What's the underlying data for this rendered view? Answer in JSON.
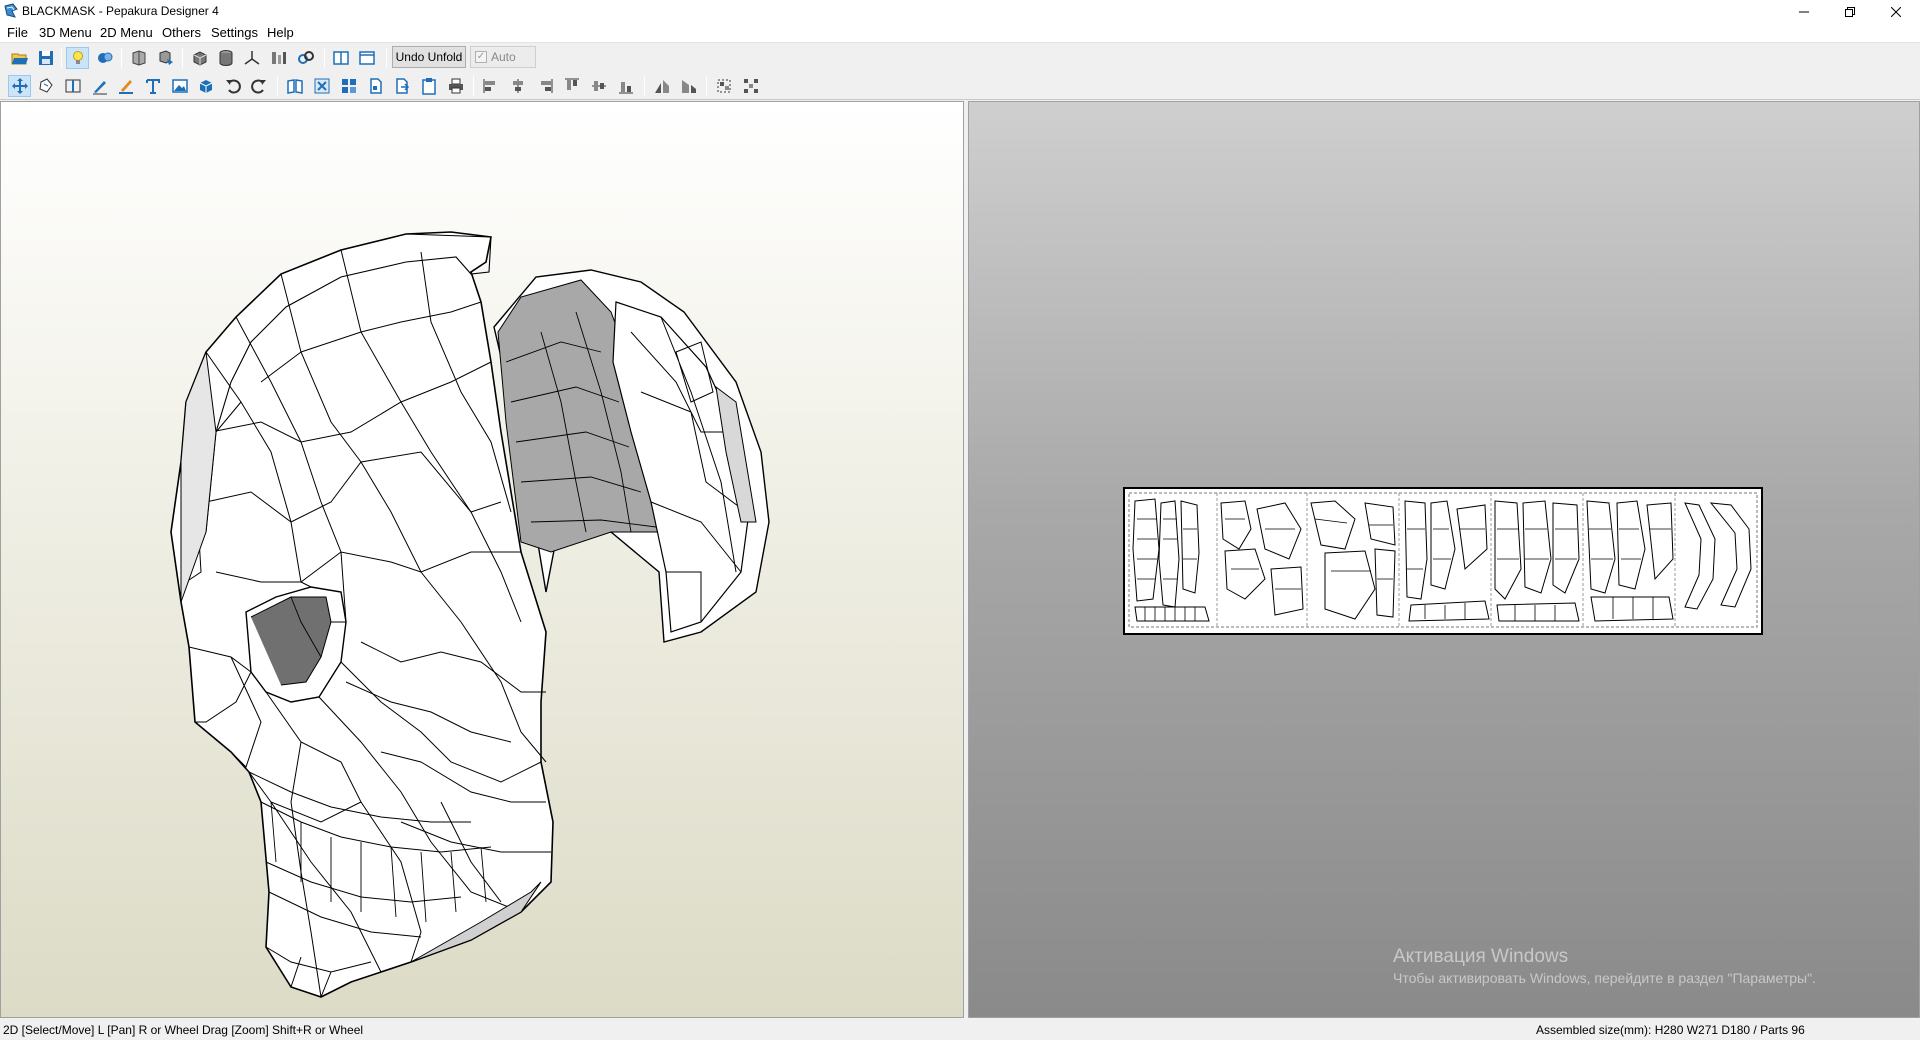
{
  "window": {
    "title": "BLACKMASK - Pepakura Designer 4"
  },
  "menu": {
    "items": [
      {
        "label": "File"
      },
      {
        "label": "3D Menu"
      },
      {
        "label": "2D Menu"
      },
      {
        "label": "Others"
      },
      {
        "label": "Settings"
      },
      {
        "label": "Help"
      }
    ]
  },
  "toolbar": {
    "undo_unfold_label": "Undo Unfold",
    "auto_label": "Auto",
    "auto_checked": true
  },
  "view2d": {
    "watermark_title": "Активация Windows",
    "watermark_subtitle": "Чтобы активировать Windows, перейдите в раздел \"Параметры\"."
  },
  "status": {
    "left": "2D [Select/Move] L [Pan] R or Wheel Drag [Zoom] Shift+R or Wheel",
    "right": "Assembled size(mm): H280 W271 D180 / Parts 96"
  },
  "colors": {
    "accent_blue": "#1e6fb8",
    "view3d_top": "#ffffff",
    "view3d_bottom": "#dcdbc6",
    "view2d_top": "#cfcfcf",
    "view2d_bottom": "#8a8a8a"
  }
}
